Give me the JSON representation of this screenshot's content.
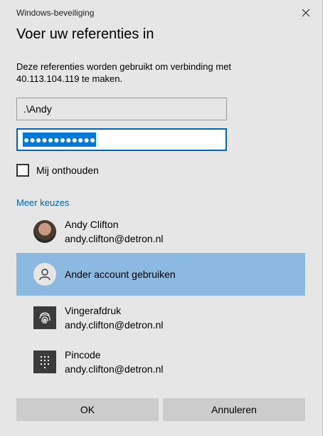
{
  "window": {
    "title": "Windows-beveiliging"
  },
  "heading": "Voer uw referenties in",
  "description": "Deze referenties worden gebruikt om verbinding met 40.113.104.119 te maken.",
  "username": {
    "value": ".\\Andy"
  },
  "password": {
    "masked": "●●●●●●●●●●●●"
  },
  "remember": {
    "label": "Mij onthouden",
    "checked": false
  },
  "more_choices": "Meer keuzes",
  "options": [
    {
      "line1": "Andy Clifton",
      "line2": "andy.clifton@detron.nl",
      "icon": "user-photo-icon"
    },
    {
      "line1": "Ander account gebruiken",
      "line2": "",
      "icon": "person-icon",
      "selected": true
    },
    {
      "line1": "Vingerafdruk",
      "line2": "andy.clifton@detron.nl",
      "icon": "fingerprint-icon"
    },
    {
      "line1": "Pincode",
      "line2": "andy.clifton@detron.nl",
      "icon": "pin-keypad-icon"
    }
  ],
  "buttons": {
    "ok": "OK",
    "cancel": "Annuleren"
  },
  "colors": {
    "accent": "#0078d7",
    "selected_row": "#8bb9e0",
    "link": "#0063b1"
  }
}
